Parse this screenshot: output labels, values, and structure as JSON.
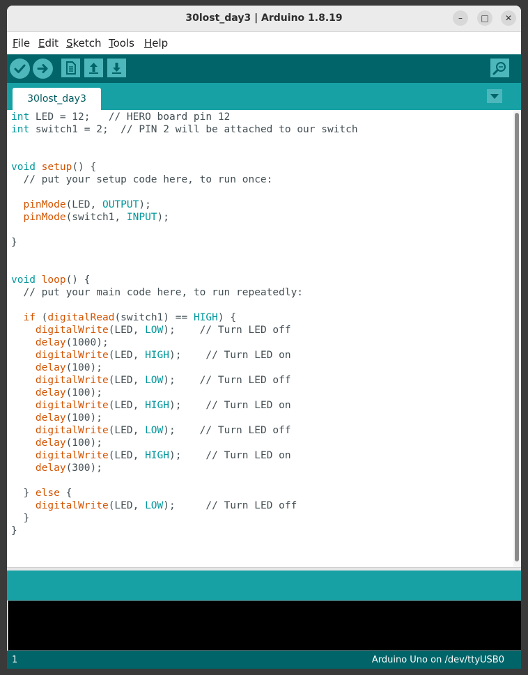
{
  "window": {
    "title": "30lost_day3 | Arduino 1.8.19"
  },
  "window_controls": [
    "minimize-icon",
    "maximize-icon",
    "close-icon"
  ],
  "menubar": {
    "items": [
      {
        "mnemonic": "F",
        "rest": "ile"
      },
      {
        "mnemonic": "E",
        "rest": "dit"
      },
      {
        "mnemonic": "S",
        "rest": "ketch"
      },
      {
        "mnemonic": "T",
        "rest": "ools"
      },
      {
        "mnemonic": "H",
        "rest": "elp"
      }
    ]
  },
  "toolbar": {
    "icons": [
      "verify-check-icon",
      "upload-arrow-icon",
      "new-file-icon",
      "open-up-arrow-icon",
      "save-down-arrow-icon",
      "serial-monitor-icon"
    ]
  },
  "tabs": [
    {
      "label": "30lost_day3"
    }
  ],
  "tab_menu_icon": "chevron-down-icon",
  "editor": {
    "lines": [
      [
        {
          "t": "int",
          "c": "k"
        },
        {
          "t": " LED = 12;   "
        },
        {
          "t": "// HERO board pin 12",
          "c": "c2"
        }
      ],
      [
        {
          "t": "int",
          "c": "k"
        },
        {
          "t": " switch1 = 2;  "
        },
        {
          "t": "// PIN 2 will be attached to our switch",
          "c": "c2"
        }
      ],
      [],
      [],
      [
        {
          "t": "void",
          "c": "k"
        },
        {
          "t": " "
        },
        {
          "t": "setup",
          "c": "f"
        },
        {
          "t": "() {"
        }
      ],
      [
        {
          "t": "  "
        },
        {
          "t": "// put your setup code here, to run once:",
          "c": "c2"
        }
      ],
      [],
      [
        {
          "t": "  "
        },
        {
          "t": "pinMode",
          "c": "f"
        },
        {
          "t": "(LED, "
        },
        {
          "t": "OUTPUT",
          "c": "k"
        },
        {
          "t": ");"
        }
      ],
      [
        {
          "t": "  "
        },
        {
          "t": "pinMode",
          "c": "f"
        },
        {
          "t": "(switch1, "
        },
        {
          "t": "INPUT",
          "c": "k"
        },
        {
          "t": ");"
        }
      ],
      [],
      [
        {
          "t": "}"
        }
      ],
      [],
      [],
      [
        {
          "t": "void",
          "c": "k"
        },
        {
          "t": " "
        },
        {
          "t": "loop",
          "c": "f"
        },
        {
          "t": "() {"
        }
      ],
      [
        {
          "t": "  "
        },
        {
          "t": "// put your main code here, to run repeatedly:",
          "c": "c2"
        }
      ],
      [],
      [
        {
          "t": "  "
        },
        {
          "t": "if",
          "c": "f"
        },
        {
          "t": " ("
        },
        {
          "t": "digitalRead",
          "c": "f"
        },
        {
          "t": "(switch1) == "
        },
        {
          "t": "HIGH",
          "c": "k"
        },
        {
          "t": ") {"
        }
      ],
      [
        {
          "t": "    "
        },
        {
          "t": "digitalWrite",
          "c": "f"
        },
        {
          "t": "(LED, "
        },
        {
          "t": "LOW",
          "c": "k"
        },
        {
          "t": ");    "
        },
        {
          "t": "// Turn LED off",
          "c": "c2"
        }
      ],
      [
        {
          "t": "    "
        },
        {
          "t": "delay",
          "c": "f"
        },
        {
          "t": "(1000);"
        }
      ],
      [
        {
          "t": "    "
        },
        {
          "t": "digitalWrite",
          "c": "f"
        },
        {
          "t": "(LED, "
        },
        {
          "t": "HIGH",
          "c": "k"
        },
        {
          "t": ");    "
        },
        {
          "t": "// Turn LED on",
          "c": "c2"
        }
      ],
      [
        {
          "t": "    "
        },
        {
          "t": "delay",
          "c": "f"
        },
        {
          "t": "(100);"
        }
      ],
      [
        {
          "t": "    "
        },
        {
          "t": "digitalWrite",
          "c": "f"
        },
        {
          "t": "(LED, "
        },
        {
          "t": "LOW",
          "c": "k"
        },
        {
          "t": ");    "
        },
        {
          "t": "// Turn LED off",
          "c": "c2"
        }
      ],
      [
        {
          "t": "    "
        },
        {
          "t": "delay",
          "c": "f"
        },
        {
          "t": "(100);"
        }
      ],
      [
        {
          "t": "    "
        },
        {
          "t": "digitalWrite",
          "c": "f"
        },
        {
          "t": "(LED, "
        },
        {
          "t": "HIGH",
          "c": "k"
        },
        {
          "t": ");    "
        },
        {
          "t": "// Turn LED on",
          "c": "c2"
        }
      ],
      [
        {
          "t": "    "
        },
        {
          "t": "delay",
          "c": "f"
        },
        {
          "t": "(100);"
        }
      ],
      [
        {
          "t": "    "
        },
        {
          "t": "digitalWrite",
          "c": "f"
        },
        {
          "t": "(LED, "
        },
        {
          "t": "LOW",
          "c": "k"
        },
        {
          "t": ");    "
        },
        {
          "t": "// Turn LED off",
          "c": "c2"
        }
      ],
      [
        {
          "t": "    "
        },
        {
          "t": "delay",
          "c": "f"
        },
        {
          "t": "(100);"
        }
      ],
      [
        {
          "t": "    "
        },
        {
          "t": "digitalWrite",
          "c": "f"
        },
        {
          "t": "(LED, "
        },
        {
          "t": "HIGH",
          "c": "k"
        },
        {
          "t": ");    "
        },
        {
          "t": "// Turn LED on",
          "c": "c2"
        }
      ],
      [
        {
          "t": "    "
        },
        {
          "t": "delay",
          "c": "f"
        },
        {
          "t": "(300);"
        }
      ],
      [],
      [
        {
          "t": "  } "
        },
        {
          "t": "else",
          "c": "f"
        },
        {
          "t": " {"
        }
      ],
      [
        {
          "t": "    "
        },
        {
          "t": "digitalWrite",
          "c": "f"
        },
        {
          "t": "(LED, "
        },
        {
          "t": "LOW",
          "c": "k"
        },
        {
          "t": ");     "
        },
        {
          "t": "// Turn LED off",
          "c": "c2"
        }
      ],
      [
        {
          "t": "  }"
        }
      ],
      [
        {
          "t": "}"
        }
      ]
    ]
  },
  "status": {
    "line": "1",
    "board": "Arduino Uno on /dev/ttyUSB0"
  },
  "colors": {
    "toolbar": "#006468",
    "tabbar": "#17a1a5",
    "button": "#4db7bb",
    "keyword": "#00979c",
    "function": "#d35400"
  }
}
